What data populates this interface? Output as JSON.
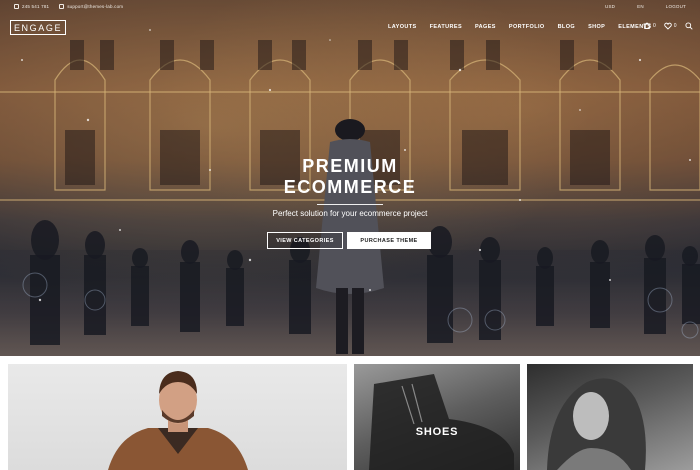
{
  "topbar": {
    "phone": "245 541 781",
    "email": "support@themes-lab.com",
    "currency": "USD",
    "language": "EN",
    "logout": "LOGOUT"
  },
  "brand": {
    "logo": "ENGAGE"
  },
  "nav": {
    "items": [
      "LAYOUTS",
      "FEATURES",
      "PAGES",
      "PORTFOLIO",
      "BLOG",
      "SHOP",
      "ELEMENTS"
    ]
  },
  "nav_icons": {
    "cart_icon": "cart-icon",
    "cart_count": "0",
    "wishlist_icon": "heart-icon",
    "wishlist_count": "0",
    "search_icon": "search-icon"
  },
  "hero": {
    "title_line1": "PREMIUM",
    "title_line2": "ECOMMERCE",
    "subtitle": "Perfect solution for your ecommerce project",
    "button_outline": "VIEW CATEGORIES",
    "button_solid": "PURCHASE THEME"
  },
  "categories": [
    {
      "label": ""
    },
    {
      "label": "SHOES"
    },
    {
      "label": ""
    }
  ]
}
